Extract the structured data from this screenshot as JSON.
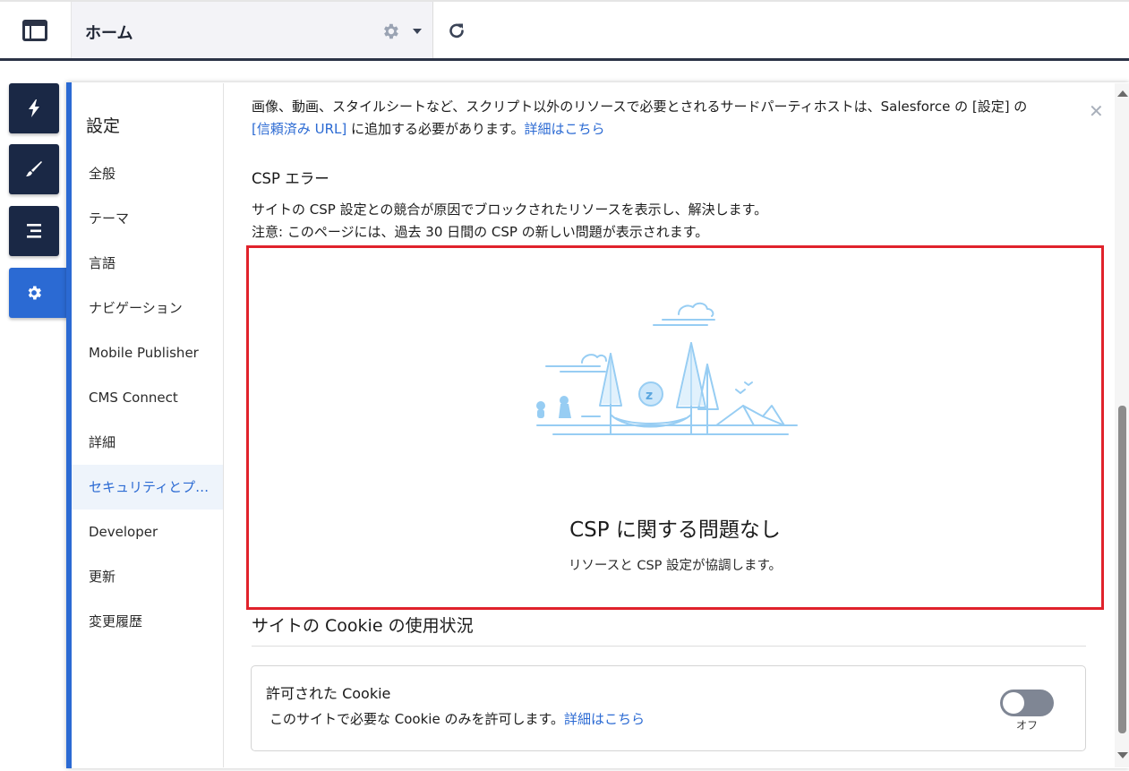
{
  "header": {
    "page_tab_title": "ホーム",
    "icons": [
      "layout-icon",
      "gear-icon",
      "caret-down-icon",
      "refresh-icon"
    ]
  },
  "rail": {
    "buttons": [
      {
        "icon": "lightning-icon"
      },
      {
        "icon": "brush-icon"
      },
      {
        "icon": "list-icon"
      },
      {
        "icon": "gear-icon",
        "active": true
      }
    ]
  },
  "settings_nav": {
    "heading": "設定",
    "items": [
      {
        "label": "全般"
      },
      {
        "label": "テーマ"
      },
      {
        "label": "言語"
      },
      {
        "label": "ナビゲーション"
      },
      {
        "label": "Mobile Publisher"
      },
      {
        "label": "CMS Connect"
      },
      {
        "label": "詳細"
      },
      {
        "label": "セキュリティとプ…",
        "selected": true
      },
      {
        "label": "Developer"
      },
      {
        "label": "更新"
      },
      {
        "label": "変更履歴"
      }
    ]
  },
  "content": {
    "intro_line1": "画像、動画、スタイルシートなど、スクリプト以外のリソースで必要とされるサードパーティホストは、Salesforce の [設定] の",
    "trusted_url_link": "[信頼済み URL]",
    "intro_line2_mid": " に追加する必要があります。",
    "intro_learn_more": "詳細はこちら",
    "csp_heading": "CSP エラー",
    "csp_desc_line1": "サイトの CSP 設定との競合が原因でブロックされたリソースを表示し、解決します。",
    "csp_desc_line2": "注意: このページには、過去 30 日間の CSP の新しい問題が表示されます。",
    "empty_state": {
      "title": "CSP に関する問題なし",
      "subtitle": "リソースと CSP 設定が協調します。",
      "illustration": "camping-hammock-illustration"
    },
    "cookie": {
      "heading": "サイトの Cookie の使用状況",
      "card_title": "許可された Cookie",
      "card_desc": "このサイトで必要な Cookie のみを許可します。",
      "card_link": "詳細はこちら",
      "toggle_label": "オフ",
      "toggle_on": false
    }
  },
  "colors": {
    "brand_blue": "#2b6ad3",
    "rail_navy": "#1a2845",
    "highlight_red": "#e0222b",
    "illustration_blue": "#97cdf3"
  }
}
